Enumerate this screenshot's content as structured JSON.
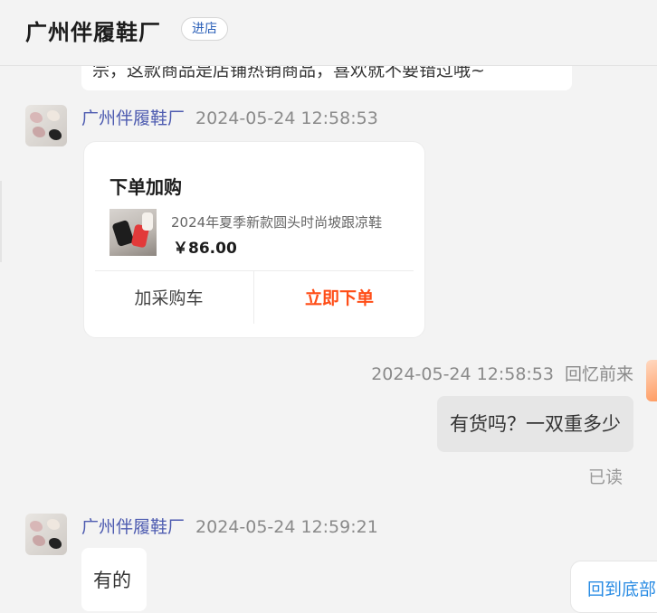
{
  "header": {
    "shop_name": "广州伴履鞋厂",
    "enter_shop_label": "进店"
  },
  "messages": {
    "clipped_text": "宗，这款商品是店铺热销商品，喜欢就不要错过哦~",
    "seller_name": "广州伴履鞋厂",
    "card_time": "2024-05-24 12:58:53",
    "card": {
      "title": "下单加购",
      "product_name": "2024年夏季新款圆头时尚坡跟凉鞋",
      "price": "￥86.00",
      "add_cart_label": "加采购车",
      "buy_now_label": "立即下单"
    },
    "buyer_time": "2024-05-24 12:58:53",
    "buyer_name": "回忆前来",
    "buyer_message": "有货吗？一双重多少",
    "read_status": "已读",
    "reply_time": "2024-05-24 12:59:21",
    "reply_text": "有的",
    "back_to_bottom_label": "回到底部"
  },
  "colors": {
    "accent_buy": "#ff4d17",
    "seller_name": "#4d5bb0",
    "link_blue": "#2a8ce4"
  }
}
